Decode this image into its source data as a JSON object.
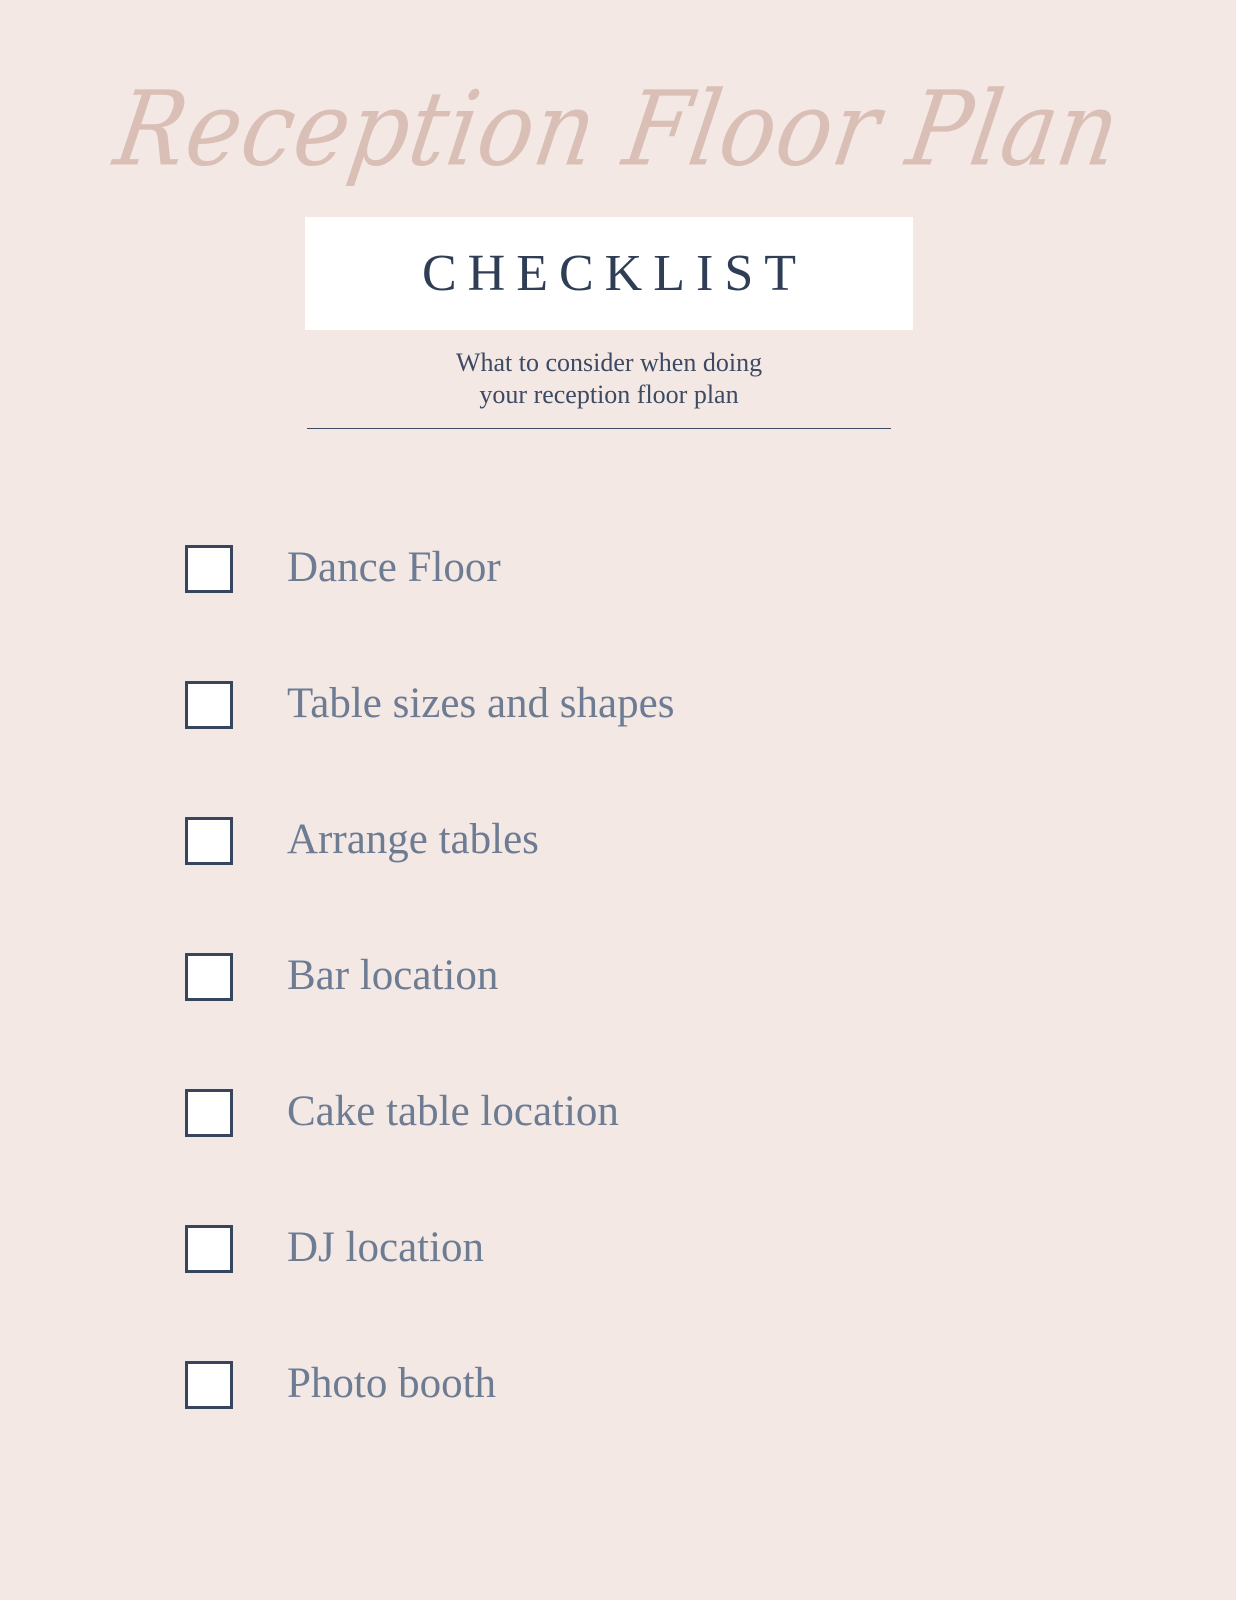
{
  "document": {
    "script_title": "Reception Floor Plan",
    "banner_title": "CHECKLIST",
    "subtitle_line1": "What to consider when doing",
    "subtitle_line2": "your reception floor plan"
  },
  "colors": {
    "background": "#f4e8e5",
    "script_title": "#d9bfb5",
    "banner_background": "#ffffff",
    "heading_text": "#2f3d55",
    "subtitle_text": "#3c4a63",
    "item_text": "#6d7c92",
    "checkbox_border": "#38455e",
    "checkbox_fill": "#ffffff",
    "divider": "#3c4a63"
  },
  "checklist": {
    "items": [
      {
        "label": "Dance Floor",
        "checked": false
      },
      {
        "label": "Table sizes and shapes",
        "checked": false
      },
      {
        "label": "Arrange tables",
        "checked": false
      },
      {
        "label": "Bar location",
        "checked": false
      },
      {
        "label": "Cake table location",
        "checked": false
      },
      {
        "label": "DJ location",
        "checked": false
      },
      {
        "label": "Photo booth",
        "checked": false
      }
    ]
  }
}
